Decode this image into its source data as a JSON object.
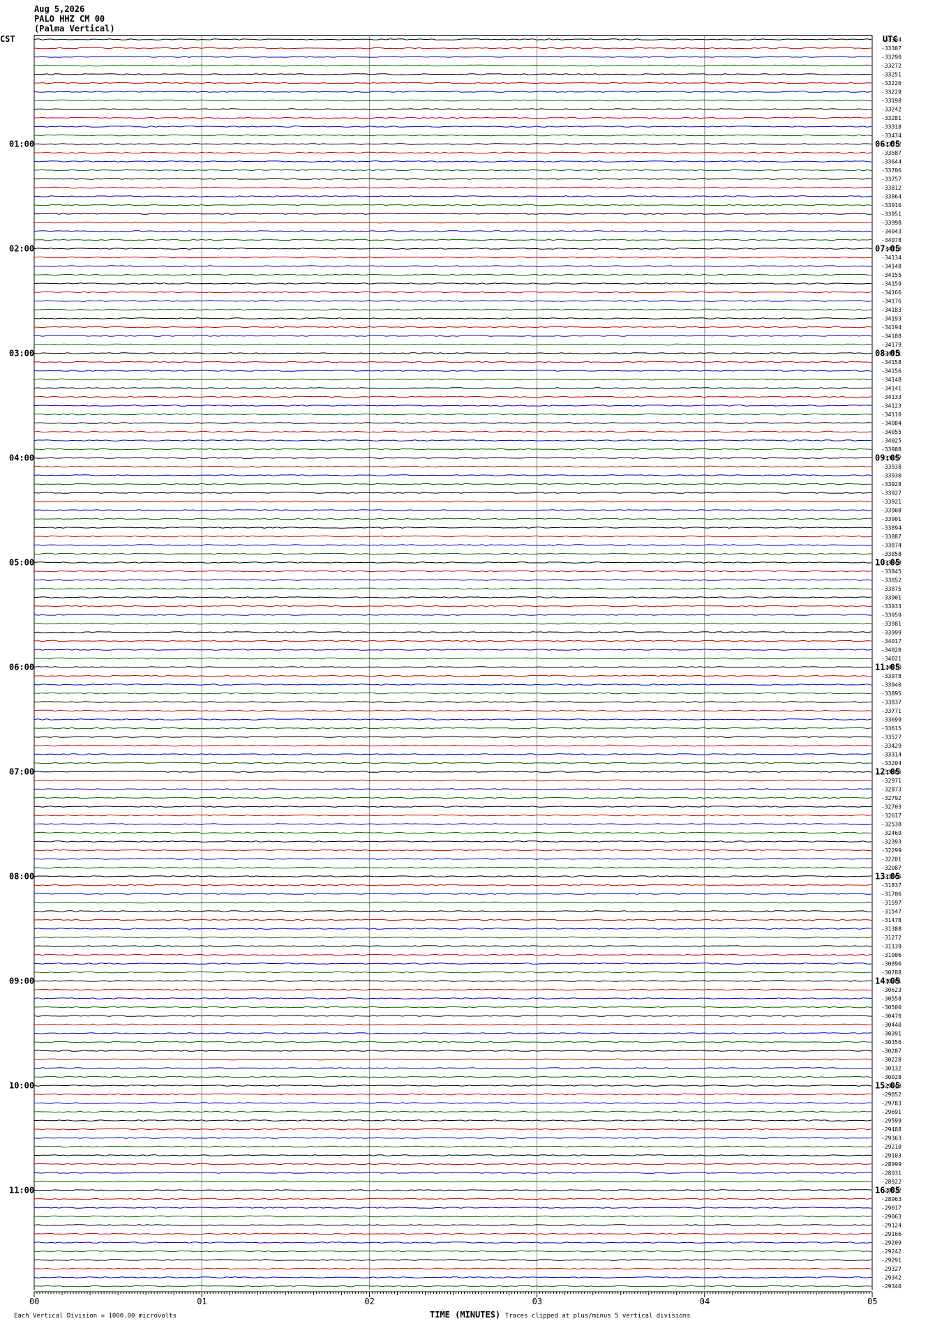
{
  "header": {
    "date": "Aug 5,2026",
    "station": "PALO HHZ CM 00",
    "location": "(Palma Vertical)"
  },
  "chart_data": {
    "type": "line",
    "left_tz_label": "CST",
    "right_tz_label": "UTC",
    "xlabel": "TIME (MINUTES)",
    "x_ticks": [
      "00",
      "01",
      "02",
      "03",
      "04",
      "05"
    ],
    "xlim": [
      0,
      5
    ],
    "footer_left": "Each Vertical Division = 1000.00 microvolts",
    "footer_right": "Traces clipped at plus/minus 5 vertical divisions",
    "left_time_labels": [
      "01:00",
      "02:00",
      "03:00",
      "04:00",
      "05:00",
      "06:00",
      "07:00",
      "08:00",
      "09:00",
      "10:00",
      "11:00"
    ],
    "right_time_labels": [
      "06:05",
      "07:05",
      "08:05",
      "09:05",
      "10:05",
      "11:05",
      "12:05",
      "13:05",
      "14:05",
      "15:05",
      "16:05"
    ],
    "hour_label_every_rows": 12,
    "first_hour_label_row": 12,
    "trace_colors": [
      "#000000",
      "#cc0000",
      "#0000cc",
      "#006600"
    ],
    "trace_count": 144,
    "trace_offsets": [
      -33304,
      -33307,
      -33290,
      -33272,
      -33251,
      -33226,
      -33229,
      -33198,
      -33242,
      -33281,
      -33318,
      -33434,
      -33512,
      -33587,
      -33644,
      -33706,
      -33757,
      -33812,
      -33864,
      -33910,
      -33951,
      -33998,
      -34043,
      -34078,
      -34110,
      -34134,
      -34148,
      -34155,
      -34159,
      -34166,
      -34176,
      -34183,
      -34193,
      -34194,
      -34188,
      -34179,
      -34171,
      -34158,
      -34156,
      -34148,
      -34141,
      -34133,
      -34123,
      -34110,
      -34084,
      -34055,
      -34025,
      -33988,
      -33957,
      -33938,
      -33930,
      -33928,
      -33927,
      -33921,
      -33908,
      -33901,
      -33894,
      -33887,
      -33874,
      -33858,
      -33848,
      -33845,
      -33852,
      -33875,
      -33901,
      -33933,
      -33959,
      -33981,
      -33999,
      -34017,
      -34020,
      -34021,
      -34010,
      -33978,
      -33940,
      -33895,
      -33837,
      -33771,
      -33699,
      -33615,
      -33527,
      -33429,
      -33314,
      -33204,
      -33085,
      -32971,
      -32873,
      -32792,
      -32703,
      -32617,
      -32538,
      -32469,
      -32393,
      -32299,
      -32201,
      -32087,
      -31966,
      -31837,
      -31706,
      -31597,
      -31547,
      -31478,
      -31388,
      -31272,
      -31139,
      -31006,
      -30896,
      -30788,
      -30701,
      -30623,
      -30558,
      -30500,
      -30470,
      -30440,
      -30391,
      -30356,
      -30287,
      -30228,
      -30132,
      -30028,
      -29943,
      -29852,
      -29783,
      -29691,
      -29599,
      -29488,
      -29363,
      -29210,
      -29103,
      -28999,
      -28931,
      -28922,
      -28932,
      -28963,
      -29017,
      -29063,
      -29124,
      -29166,
      -29209,
      -29242,
      -29291,
      -29327,
      -29342,
      -29340
    ]
  }
}
